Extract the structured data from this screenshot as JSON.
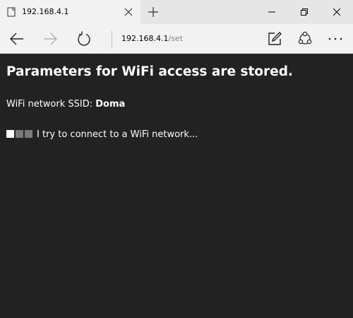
{
  "tab": {
    "title": "192.168.4.1"
  },
  "address_bar": {
    "host": "192.168.4.1",
    "path": "/set"
  },
  "page": {
    "heading": "Parameters for WiFi access are stored.",
    "ssid_label": "WiFi network SSID: ",
    "ssid_value": "Doma",
    "status_text": "I try to connect to a WiFi network...",
    "progress": {
      "total": 3,
      "active": 1
    }
  },
  "icons": {
    "tab": [
      "page-favicon-icon",
      "close-icon",
      "plus-icon"
    ],
    "window": [
      "minimize-icon",
      "restore-icon",
      "close-icon"
    ],
    "nav": [
      "back-arrow-icon",
      "forward-arrow-icon",
      "refresh-icon",
      "web-note-icon",
      "share-icon",
      "more-icon"
    ]
  },
  "colors": {
    "page_background": "#222222",
    "page_text": "#ffffff",
    "chrome_background": "#f2f2f2",
    "tabbar_background": "#e6e6e6",
    "progress_active": "#ffffff",
    "progress_inactive": "#7a7a7a",
    "disabled_icon": "#b3b3b3",
    "url_path": "#888888"
  }
}
